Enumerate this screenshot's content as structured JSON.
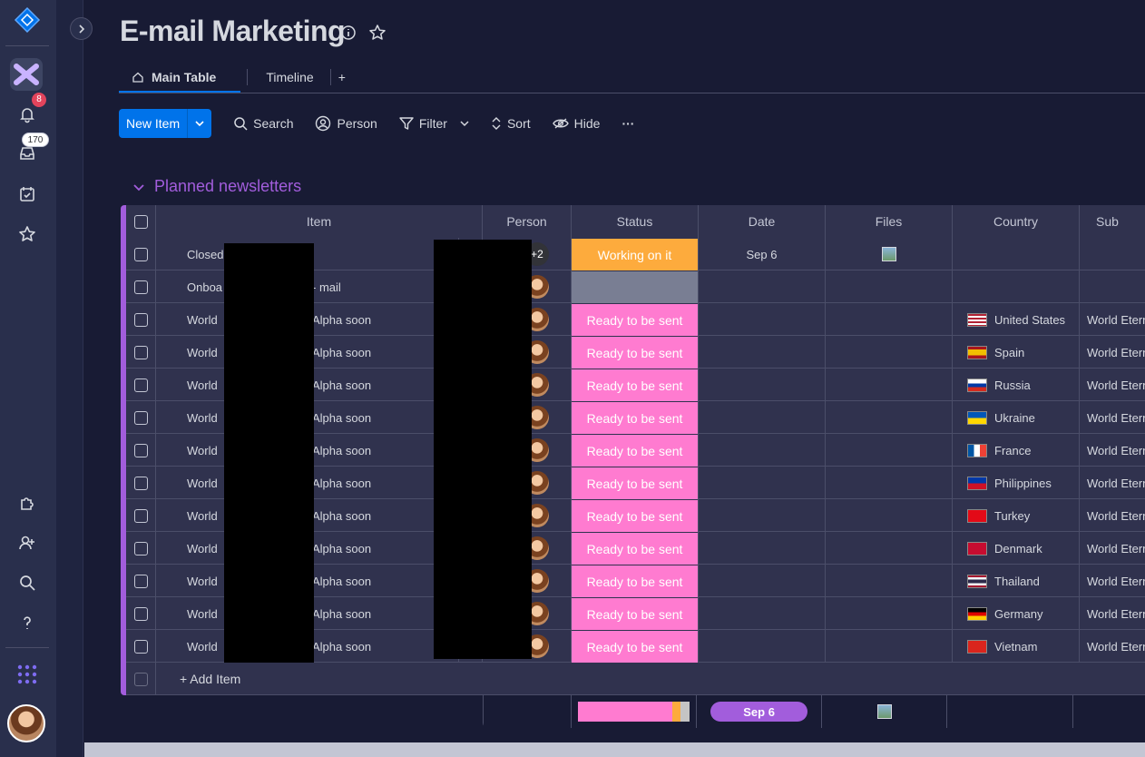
{
  "board": {
    "title": "E-mail Marketing",
    "tabs": [
      {
        "label": "Main Table",
        "active": true
      },
      {
        "label": "Timeline",
        "active": false
      },
      {
        "label": "+",
        "active": false
      }
    ]
  },
  "rail": {
    "notifications_count": "8",
    "inbox_count": "170"
  },
  "toolbar": {
    "new_item": "New Item",
    "search": "Search",
    "person": "Person",
    "filter": "Filter",
    "sort": "Sort",
    "hide": "Hide",
    "more": "···"
  },
  "group": {
    "title": "Planned newsletters",
    "color": "#a25ddc",
    "columns": [
      "Item",
      "Person",
      "Status",
      "Date",
      "Files",
      "Country",
      "Sub"
    ],
    "rows": [
      {
        "item_left": "Closed",
        "item_right": "",
        "person": "+2",
        "status": "Working on it",
        "status_color": "#fdab3d",
        "date": "Sep 6",
        "file": true,
        "country": "",
        "flag": "",
        "sub": ""
      },
      {
        "item_left": "Onboa",
        "item_right": "- mail",
        "person": "face",
        "status": "",
        "status_color": "#797e93",
        "date": "",
        "file": false,
        "country": "",
        "flag": "",
        "sub": ""
      },
      {
        "item_left": "World",
        "item_right": "Alpha soon",
        "person": "face",
        "status": "Ready to be sent",
        "status_color": "#ff7bd0",
        "date": "",
        "file": false,
        "country": "United States",
        "flag": "us",
        "sub": "World Etern"
      },
      {
        "item_left": "World",
        "item_right": "Alpha soon",
        "person": "face",
        "status": "Ready to be sent",
        "status_color": "#ff7bd0",
        "date": "",
        "file": false,
        "country": "Spain",
        "flag": "es",
        "sub": "World Etern"
      },
      {
        "item_left": "World",
        "item_right": "Alpha soon",
        "person": "face",
        "status": "Ready to be sent",
        "status_color": "#ff7bd0",
        "date": "",
        "file": false,
        "country": "Russia",
        "flag": "ru",
        "sub": "World Etern"
      },
      {
        "item_left": "World",
        "item_right": "Alpha soon",
        "person": "face",
        "status": "Ready to be sent",
        "status_color": "#ff7bd0",
        "date": "",
        "file": false,
        "country": "Ukraine",
        "flag": "ua",
        "sub": "World Etern"
      },
      {
        "item_left": "World",
        "item_right": "Alpha soon",
        "person": "face",
        "status": "Ready to be sent",
        "status_color": "#ff7bd0",
        "date": "",
        "file": false,
        "country": "France",
        "flag": "fr",
        "sub": "World Etern"
      },
      {
        "item_left": "World",
        "item_right": "Alpha soon",
        "person": "face",
        "status": "Ready to be sent",
        "status_color": "#ff7bd0",
        "date": "",
        "file": false,
        "country": "Philippines",
        "flag": "ph",
        "sub": "World Etern"
      },
      {
        "item_left": "World",
        "item_right": "Alpha soon",
        "person": "face",
        "status": "Ready to be sent",
        "status_color": "#ff7bd0",
        "date": "",
        "file": false,
        "country": "Turkey",
        "flag": "tr",
        "sub": "World Etern"
      },
      {
        "item_left": "World",
        "item_right": "Alpha soon",
        "person": "face",
        "status": "Ready to be sent",
        "status_color": "#ff7bd0",
        "date": "",
        "file": false,
        "country": "Denmark",
        "flag": "dk",
        "sub": "World Etern"
      },
      {
        "item_left": "World",
        "item_right": "Alpha soon",
        "person": "face",
        "status": "Ready to be sent",
        "status_color": "#ff7bd0",
        "date": "",
        "file": false,
        "country": "Thailand",
        "flag": "th",
        "sub": "World Etern"
      },
      {
        "item_left": "World",
        "item_right": "Alpha soon",
        "person": "face",
        "status": "Ready to be sent",
        "status_color": "#ff7bd0",
        "date": "",
        "file": false,
        "country": "Germany",
        "flag": "de",
        "sub": "World Etern"
      },
      {
        "item_left": "World",
        "item_right": "Alpha soon",
        "person": "face",
        "status": "Ready to be sent",
        "status_color": "#ff7bd0",
        "date": "",
        "file": false,
        "country": "Vietnam",
        "flag": "vn",
        "sub": "World Etern"
      }
    ],
    "add_item": "+ Add Item",
    "summary": {
      "date": "Sep 6",
      "status_breakdown": [
        {
          "color": "#ff7bd0",
          "fraction": 0.846
        },
        {
          "color": "#fdab3d",
          "fraction": 0.077
        },
        {
          "color": "#c4c4c4",
          "fraction": 0.077
        }
      ]
    }
  },
  "colors": {
    "accent": "#0073ea",
    "group": "#a25ddc",
    "background": "#181b34"
  }
}
